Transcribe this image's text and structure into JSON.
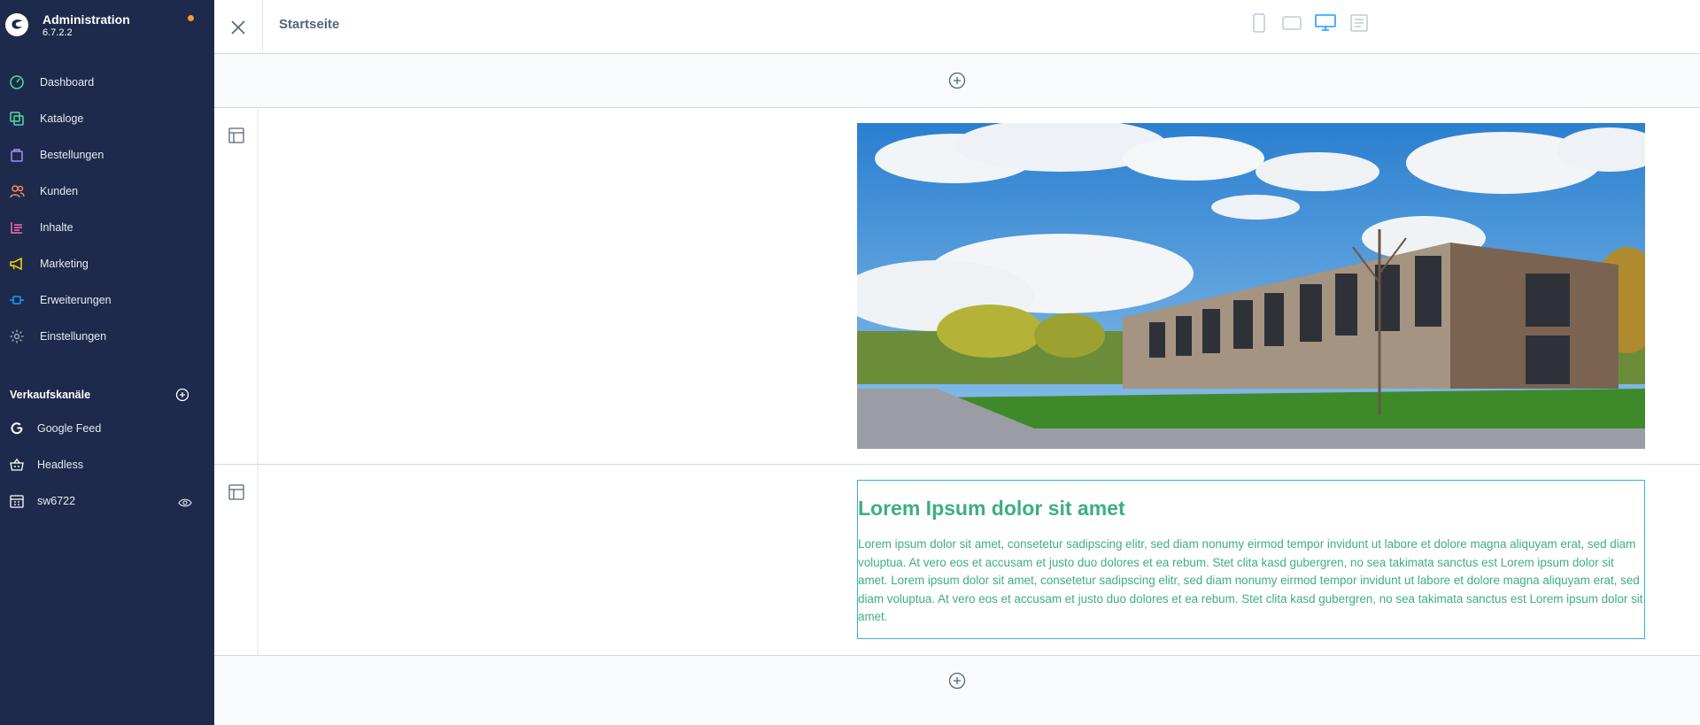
{
  "app": {
    "title": "Administration",
    "version": "6.7.2.2",
    "accent": "#189eff",
    "status_dot_color": "#ff9a1e"
  },
  "sidebar": {
    "items": [
      {
        "label": "Dashboard",
        "icon": "dashboard-gauge-icon",
        "color": "#57d9a3"
      },
      {
        "label": "Kataloge",
        "icon": "catalog-icon",
        "color": "#57d9a3"
      },
      {
        "label": "Bestellungen",
        "icon": "shopping-bag-icon",
        "color": "#a092f0"
      },
      {
        "label": "Kunden",
        "icon": "users-icon",
        "color": "#f88962"
      },
      {
        "label": "Inhalte",
        "icon": "content-list-icon",
        "color": "#ff68b4"
      },
      {
        "label": "Marketing",
        "icon": "megaphone-icon",
        "color": "#ffd700"
      },
      {
        "label": "Erweiterungen",
        "icon": "plug-icon",
        "color": "#189eff"
      },
      {
        "label": "Einstellungen",
        "icon": "gear-icon",
        "color": "#9aa8b5"
      }
    ],
    "sales_channels_title": "Verkaufskanäle",
    "channels": [
      {
        "label": "Google Feed",
        "icon": "google-icon"
      },
      {
        "label": "Headless",
        "icon": "basket-icon"
      },
      {
        "label": "sw6722",
        "icon": "storefront-icon"
      }
    ]
  },
  "topbar": {
    "page_title": "Startseite",
    "viewports": [
      "mobile-icon",
      "tablet-icon",
      "desktop-icon",
      "form-icon"
    ],
    "active_viewport": "desktop-icon"
  },
  "content": {
    "text_block": {
      "heading": "Lorem Ipsum dolor sit amet",
      "body": "Lorem ipsum dolor sit amet, consetetur sadipscing elitr, sed diam nonumy eirmod tempor invidunt ut labore et dolore magna aliquyam erat, sed diam voluptua. At vero eos et accusam et justo duo dolores et ea rebum. Stet clita kasd gubergren, no sea takimata sanctus est Lorem ipsum dolor sit amet. Lorem ipsum dolor sit amet, consetetur sadipscing elitr, sed diam nonumy eirmod tempor invidunt ut labore et dolore magna aliquyam erat, sed diam voluptua. At vero eos et accusam et justo duo dolores et ea rebum. Stet clita kasd gubergren, no sea takimata sanctus est Lorem ipsum dolor sit amet.",
      "color": "#3dae82"
    }
  }
}
